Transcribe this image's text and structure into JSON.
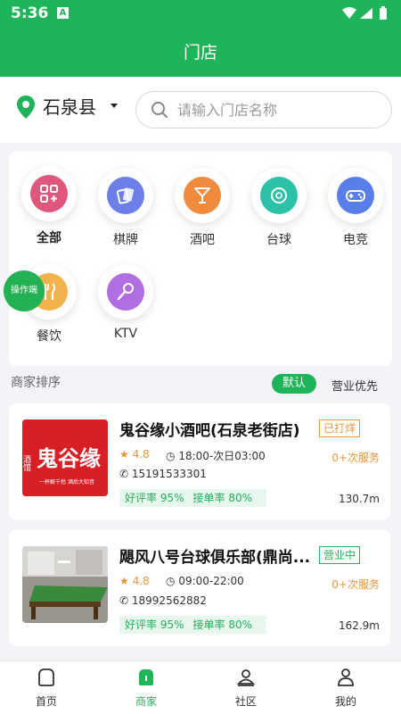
{
  "status_bar": {
    "time": "5:36",
    "notif_letter": "A"
  },
  "header": {
    "title": "门店"
  },
  "location": {
    "city": "石泉县"
  },
  "search": {
    "placeholder": "请输入门店名称"
  },
  "categories": [
    {
      "label": "全部",
      "color": "#e0577e",
      "icon": "grid-icon"
    },
    {
      "label": "棋牌",
      "color": "#6c7ee8",
      "icon": "cards-icon"
    },
    {
      "label": "酒吧",
      "color": "#f08a3c",
      "icon": "cocktail-icon"
    },
    {
      "label": "台球",
      "color": "#2cc2a8",
      "icon": "billiard-ball-icon"
    },
    {
      "label": "电竞",
      "color": "#5a7ee8",
      "icon": "gamepad-icon"
    },
    {
      "label": "餐饮",
      "color": "#f3b24c",
      "icon": "utensils-icon"
    },
    {
      "label": "KTV",
      "color": "#b06ee0",
      "icon": "microphone-icon"
    }
  ],
  "float_button": {
    "label": "操作端"
  },
  "sort": {
    "title": "商家排序",
    "default_label": "默认",
    "open_first_label": "营业优先"
  },
  "stores": [
    {
      "name": "鬼谷缘小酒吧(石泉老街店)",
      "status": "已打烊",
      "rating": "4.8",
      "hours": "18:00-次日03:00",
      "phone": "15191533301",
      "services": "0+次服务",
      "good_rate": "好评率 95%",
      "accept_rate": "接单率 80%",
      "distance": "130.7m",
      "thumb_text": "鬼谷缘",
      "thumb_side": "酒馆",
      "thumb_slogan": "一杯解千愁 酒后大知音"
    },
    {
      "name": "飓风八号台球俱乐部(鼎尚...",
      "status": "营业中",
      "rating": "4.8",
      "hours": "09:00-22:00",
      "phone": "18992562882",
      "services": "0+次服务",
      "good_rate": "好评率 95%",
      "accept_rate": "接单率 80%",
      "distance": "162.9m"
    }
  ],
  "tabbar": [
    {
      "label": "首页",
      "icon": "home-icon"
    },
    {
      "label": "商家",
      "icon": "store-icon"
    },
    {
      "label": "社区",
      "icon": "community-icon"
    },
    {
      "label": "我的",
      "icon": "profile-icon"
    }
  ],
  "colors": {
    "brand": "#1fb35a",
    "accent_orange": "#e8953a"
  }
}
